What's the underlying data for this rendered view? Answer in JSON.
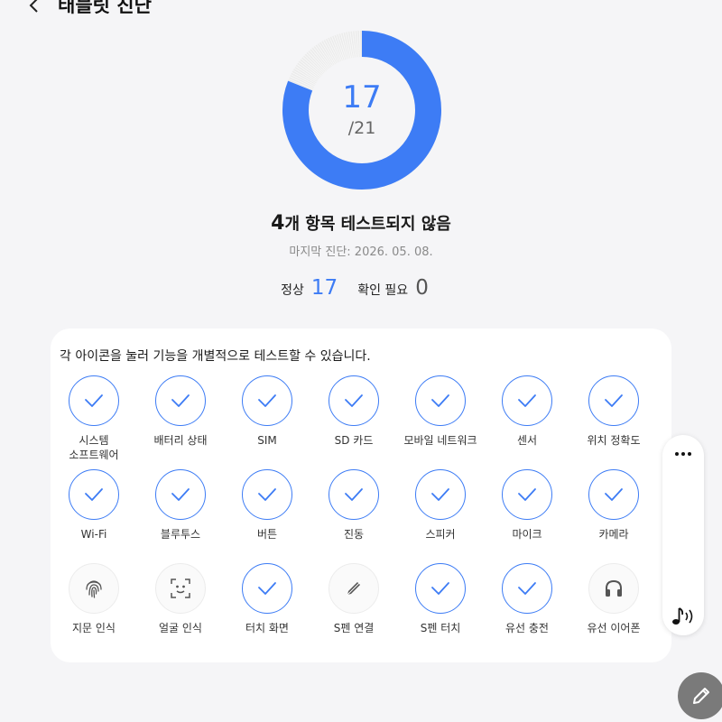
{
  "header": {
    "title": "태블릿 진단",
    "back_icon": "chevron-left-icon"
  },
  "progress": {
    "passed_count": "17",
    "total_label": "/21",
    "passed": 17,
    "total": 21,
    "accent_color": "#3d7cf5"
  },
  "summary": {
    "untested_count": "4",
    "untested_text": "개 항목 테스트되지 않음",
    "last_diagnosis": "마지막 진단: 2026. 05. 08."
  },
  "stats": {
    "normal_label": "정상",
    "normal_value": "17",
    "check_label": "확인 필요",
    "check_value": "0"
  },
  "card": {
    "description": "각 아이콘을 눌러 기능을 개별적으로 테스트할 수 있습니다.",
    "items": [
      {
        "label": "시스템\n소프트웨어",
        "status": "passed"
      },
      {
        "label": "배터리 상태",
        "status": "passed"
      },
      {
        "label": "SIM",
        "status": "passed"
      },
      {
        "label": "SD 카드",
        "status": "passed"
      },
      {
        "label": "모바일 네트워크",
        "status": "passed"
      },
      {
        "label": "센서",
        "status": "passed"
      },
      {
        "label": "위치 정확도",
        "status": "passed"
      },
      {
        "label": "Wi-Fi",
        "status": "passed"
      },
      {
        "label": "블루투스",
        "status": "passed"
      },
      {
        "label": "버튼",
        "status": "passed"
      },
      {
        "label": "진동",
        "status": "passed"
      },
      {
        "label": "스피커",
        "status": "passed"
      },
      {
        "label": "마이크",
        "status": "passed"
      },
      {
        "label": "카메라",
        "status": "passed"
      },
      {
        "label": "지문 인식",
        "status": "untested",
        "icon": "fingerprint-icon"
      },
      {
        "label": "얼굴 인식",
        "status": "untested",
        "icon": "face-scan-icon"
      },
      {
        "label": "터치 화면",
        "status": "passed"
      },
      {
        "label": "S펜 연결",
        "status": "untested",
        "icon": "pen-icon"
      },
      {
        "label": "S펜 터치",
        "status": "passed"
      },
      {
        "label": "유선 충전",
        "status": "passed"
      },
      {
        "label": "유선 이어폰",
        "status": "untested",
        "icon": "headphones-icon"
      }
    ]
  },
  "side_panel": {
    "more_icon": "more-dots-icon",
    "sound_icon": "music-note-sound-icon"
  },
  "fab": {
    "icon": "pencil-icon"
  }
}
